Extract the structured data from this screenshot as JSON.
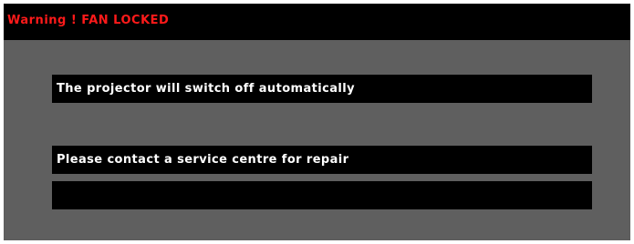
{
  "dialog": {
    "title": "Warning ! FAN LOCKED",
    "messages": [
      "The projector will switch off automatically",
      "Please contact a service centre for repair",
      ""
    ]
  },
  "colors": {
    "window_background": "#5f5f5f",
    "title_bar_background": "#000000",
    "title_text": "#ff1a1a",
    "message_background": "#000000",
    "message_text": "#ffffff"
  }
}
